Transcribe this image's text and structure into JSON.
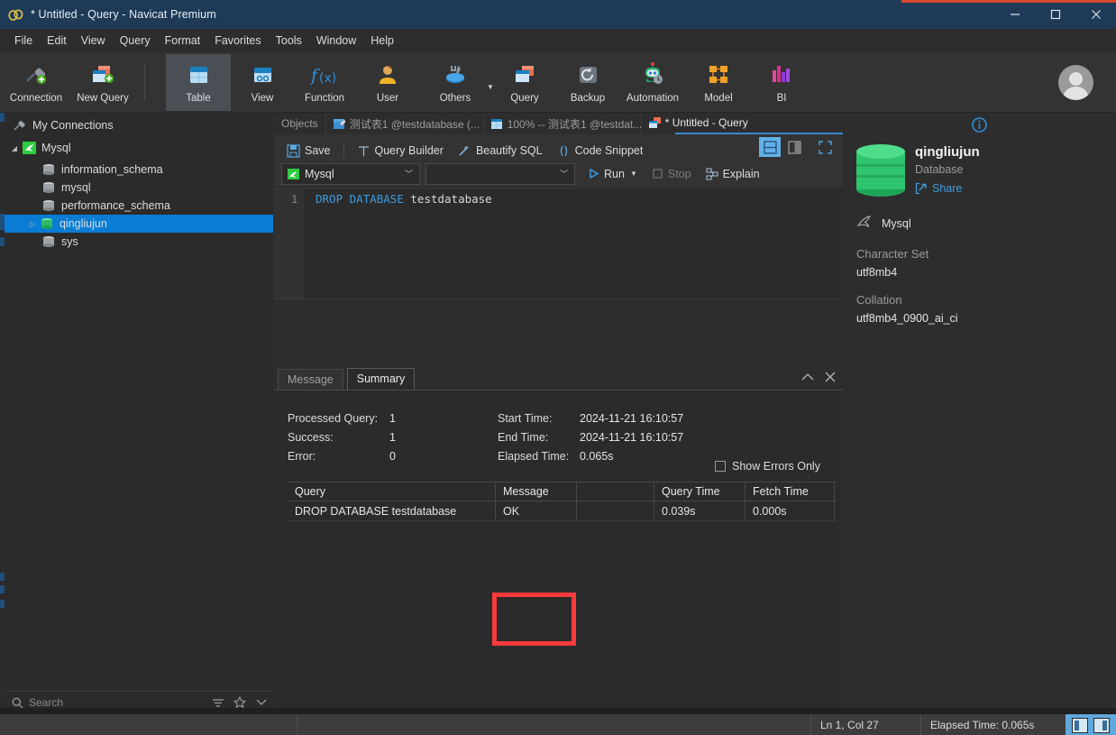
{
  "window": {
    "title": "* Untitled - Query - Navicat Premium",
    "minimize_label": "Minimize",
    "maximize_label": "Maximize",
    "close_label": "Close",
    "accent_color": "#1e3a57",
    "accent_red": "#d9482c"
  },
  "menubar": {
    "items": [
      {
        "label": "File"
      },
      {
        "label": "Edit"
      },
      {
        "label": "View"
      },
      {
        "label": "Query"
      },
      {
        "label": "Format"
      },
      {
        "label": "Favorites"
      },
      {
        "label": "Tools"
      },
      {
        "label": "Window"
      },
      {
        "label": "Help"
      }
    ]
  },
  "toolbar": {
    "items": [
      {
        "label": "Connection",
        "icon": "connection-plug-icon",
        "active": false
      },
      {
        "label": "New Query",
        "icon": "new-query-icon",
        "active": false
      },
      {
        "label": "Table",
        "icon": "table-icon",
        "active": true
      },
      {
        "label": "View",
        "icon": "view-icon",
        "active": false
      },
      {
        "label": "Function",
        "icon": "function-fx-icon",
        "active": false
      },
      {
        "label": "User",
        "icon": "user-icon",
        "active": false
      },
      {
        "label": "Others",
        "icon": "others-tools-icon",
        "active": false
      },
      {
        "label": "Query",
        "icon": "query-icon",
        "active": false
      },
      {
        "label": "Backup",
        "icon": "backup-icon",
        "active": false
      },
      {
        "label": "Automation",
        "icon": "automation-robot-icon",
        "active": false
      },
      {
        "label": "Model",
        "icon": "model-icon",
        "active": false
      },
      {
        "label": "BI",
        "icon": "bi-chart-icon",
        "active": false
      }
    ],
    "avatar_name": "user-avatar"
  },
  "sidebar": {
    "root": {
      "label": "My Connections",
      "icon": "connections-icon"
    },
    "connection": {
      "label": "Mysql",
      "icon": "mysql-dolphin-icon",
      "expanded": true
    },
    "databases": [
      {
        "label": "information_schema",
        "selected": false,
        "expandable": false
      },
      {
        "label": "mysql",
        "selected": false,
        "expandable": false
      },
      {
        "label": "performance_schema",
        "selected": false,
        "expandable": false
      },
      {
        "label": "qingliujun",
        "selected": true,
        "expandable": true
      },
      {
        "label": "sys",
        "selected": false,
        "expandable": false
      }
    ],
    "search": {
      "placeholder": "Search",
      "icon": "search-icon",
      "tools": [
        "filter-icon",
        "star-icon",
        "collapse-all-icon"
      ]
    }
  },
  "tabs": [
    {
      "label": "Objects",
      "icon": "",
      "active": false
    },
    {
      "label": "测试表1 @testdatabase (...",
      "icon": "table-tab-icon",
      "active": false
    },
    {
      "label": "100% -- 测试表1 @testdat...",
      "icon": "data-tab-icon",
      "active": false
    },
    {
      "label": "* Untitled - Query",
      "icon": "query-tab-icon",
      "active": true
    }
  ],
  "query_toolbar": {
    "save": "Save",
    "query_builder": "Query Builder",
    "beautify_sql": "Beautify SQL",
    "code_snippet": "Code Snippet",
    "connection_select": "Mysql",
    "database_select": "",
    "run": "Run",
    "stop": "Stop",
    "explain": "Explain",
    "view_toggle_horizontal": "horizontal-split-icon",
    "view_toggle_vertical": "vertical-split-icon",
    "view_fullscreen": "fullscreen-icon"
  },
  "editor": {
    "line_number": "1",
    "keyword1": "DROP",
    "keyword2": "DATABASE",
    "identifier": "testdatabase"
  },
  "result_panel": {
    "tabs": [
      {
        "label": "Message",
        "active": false
      },
      {
        "label": "Summary",
        "active": true
      }
    ],
    "tools": [
      "collapse-chevron-icon",
      "close-icon"
    ],
    "summary": {
      "processed_query_label": "Processed Query:",
      "processed_query_value": "1",
      "success_label": "Success:",
      "success_value": "1",
      "error_label": "Error:",
      "error_value": "0",
      "start_time_label": "Start Time:",
      "start_time_value": "2024-11-21 16:10:57",
      "end_time_label": "End Time:",
      "end_time_value": "2024-11-21 16:10:57",
      "elapsed_time_label": "Elapsed Time:",
      "elapsed_time_value": "0.065s",
      "show_errors_only": "Show Errors Only",
      "show_errors_checked": false
    },
    "table": {
      "columns": [
        "Query",
        "Message",
        "",
        "Query Time",
        "Fetch Time"
      ],
      "rows": [
        [
          "DROP DATABASE testdatabase",
          "OK",
          "",
          "0.039s",
          "0.000s"
        ]
      ]
    },
    "annotation": {
      "name": "message-column-highlight",
      "color": "#fb3b3b"
    }
  },
  "info_panel": {
    "info_icon": "info-circle-icon",
    "db_name": "qingliujun",
    "db_type": "Database",
    "share": "Share",
    "connection_name": "Mysql",
    "character_set_label": "Character Set",
    "character_set_value": "utf8mb4",
    "collation_label": "Collation",
    "collation_value": "utf8mb4_0900_ai_ci"
  },
  "statusbar": {
    "cursor_position": "Ln 1, Col 27",
    "elapsed_time": "Elapsed Time: 0.065s",
    "layout_left": "list-view-toggle",
    "layout_right": "form-view-toggle"
  }
}
